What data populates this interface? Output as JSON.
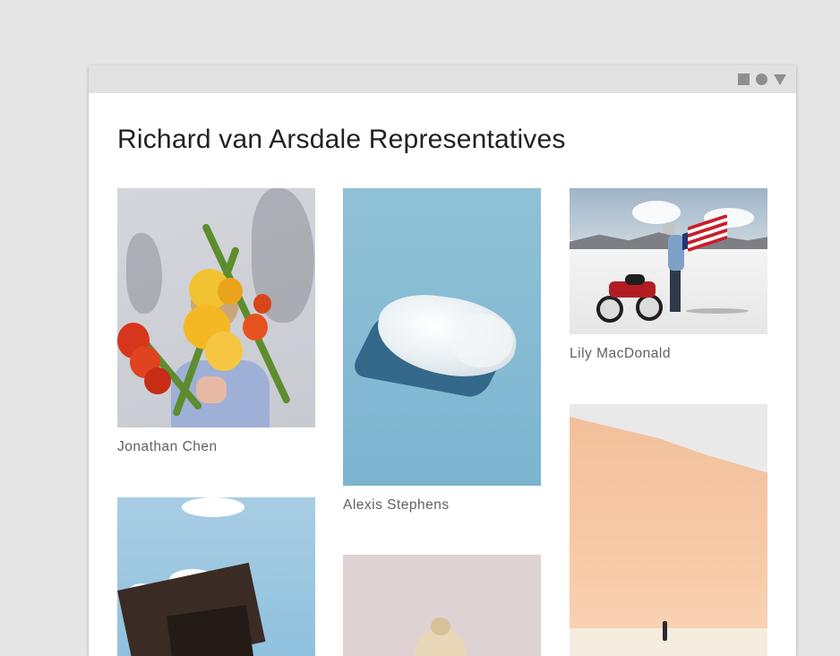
{
  "window": {
    "controls": [
      "square-icon",
      "circle-icon",
      "triangle-down-icon"
    ]
  },
  "page": {
    "title": "Richard van Arsdale Representatives"
  },
  "gallery": {
    "items": [
      {
        "name": "Jonathan Chen",
        "photo": "flowers"
      },
      {
        "name": "Alexis Stephens",
        "photo": "crystal"
      },
      {
        "name": "Lily MacDonald",
        "photo": "motorbike"
      },
      {
        "name": "",
        "photo": "sky-book"
      },
      {
        "name": "",
        "photo": "pink-portrait"
      },
      {
        "name": "",
        "photo": "desert-dune"
      }
    ]
  },
  "colors": {
    "background": "#e6e6e6",
    "titlebar": "#e1e1e1",
    "control": "#8e8e8e",
    "title_text": "#222222",
    "caption_text": "#616161"
  }
}
